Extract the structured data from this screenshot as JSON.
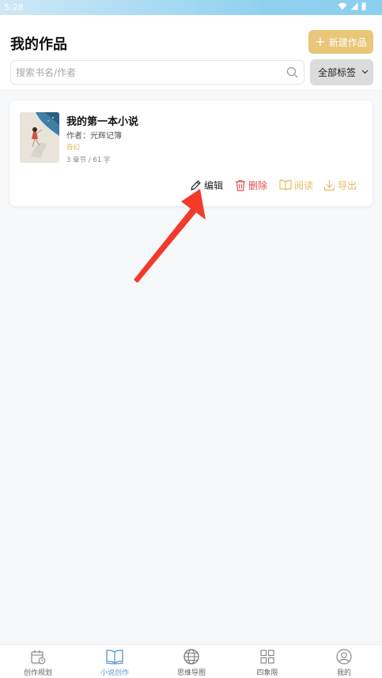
{
  "status_bar": {
    "time": "5:28"
  },
  "header": {
    "title": "我的作品",
    "new_button_label": "新建作品"
  },
  "search": {
    "placeholder": "搜索书名/作者",
    "value": ""
  },
  "tag_filter": {
    "selected": "全部标签"
  },
  "books": [
    {
      "title": "我的第一本小说",
      "author": "作者：光辉记簿",
      "tag": "奇幻",
      "stats": "3 章节 / 61 字",
      "actions": {
        "edit": "编辑",
        "delete": "删除",
        "read": "阅读",
        "export": "导出"
      }
    }
  ],
  "bottom_nav": [
    {
      "label": "创作规划",
      "icon": "calendar-icon",
      "active": false
    },
    {
      "label": "小说创作",
      "icon": "book-icon",
      "active": true
    },
    {
      "label": "思维导图",
      "icon": "globe-icon",
      "active": false
    },
    {
      "label": "四象限",
      "icon": "grid-icon",
      "active": false
    },
    {
      "label": "我的",
      "icon": "user-icon",
      "active": false
    }
  ],
  "colors": {
    "accent": "#e9c679",
    "delete": "#e24c4c",
    "nav_active": "#5e9ad6",
    "annotation_arrow": "#f23b2a"
  }
}
